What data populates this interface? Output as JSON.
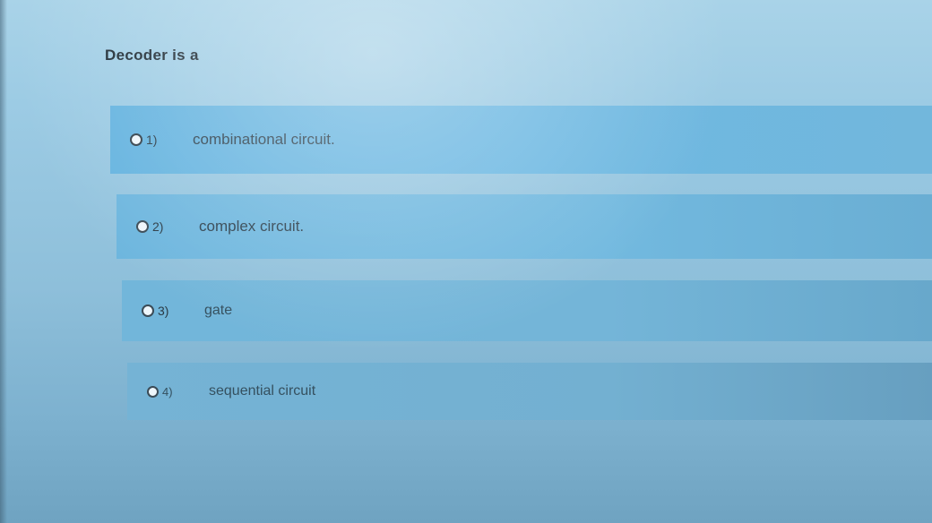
{
  "question": {
    "text": "Decoder is a"
  },
  "options": [
    {
      "number": "1)",
      "label": "combinational circuit."
    },
    {
      "number": "2)",
      "label": "complex circuit."
    },
    {
      "number": "3)",
      "label": "gate"
    },
    {
      "number": "4)",
      "label": "sequential circuit"
    }
  ],
  "colors": {
    "option_background": "#6ab6e0",
    "page_background": "#9ccbe4",
    "text": "#2b3f4c"
  }
}
